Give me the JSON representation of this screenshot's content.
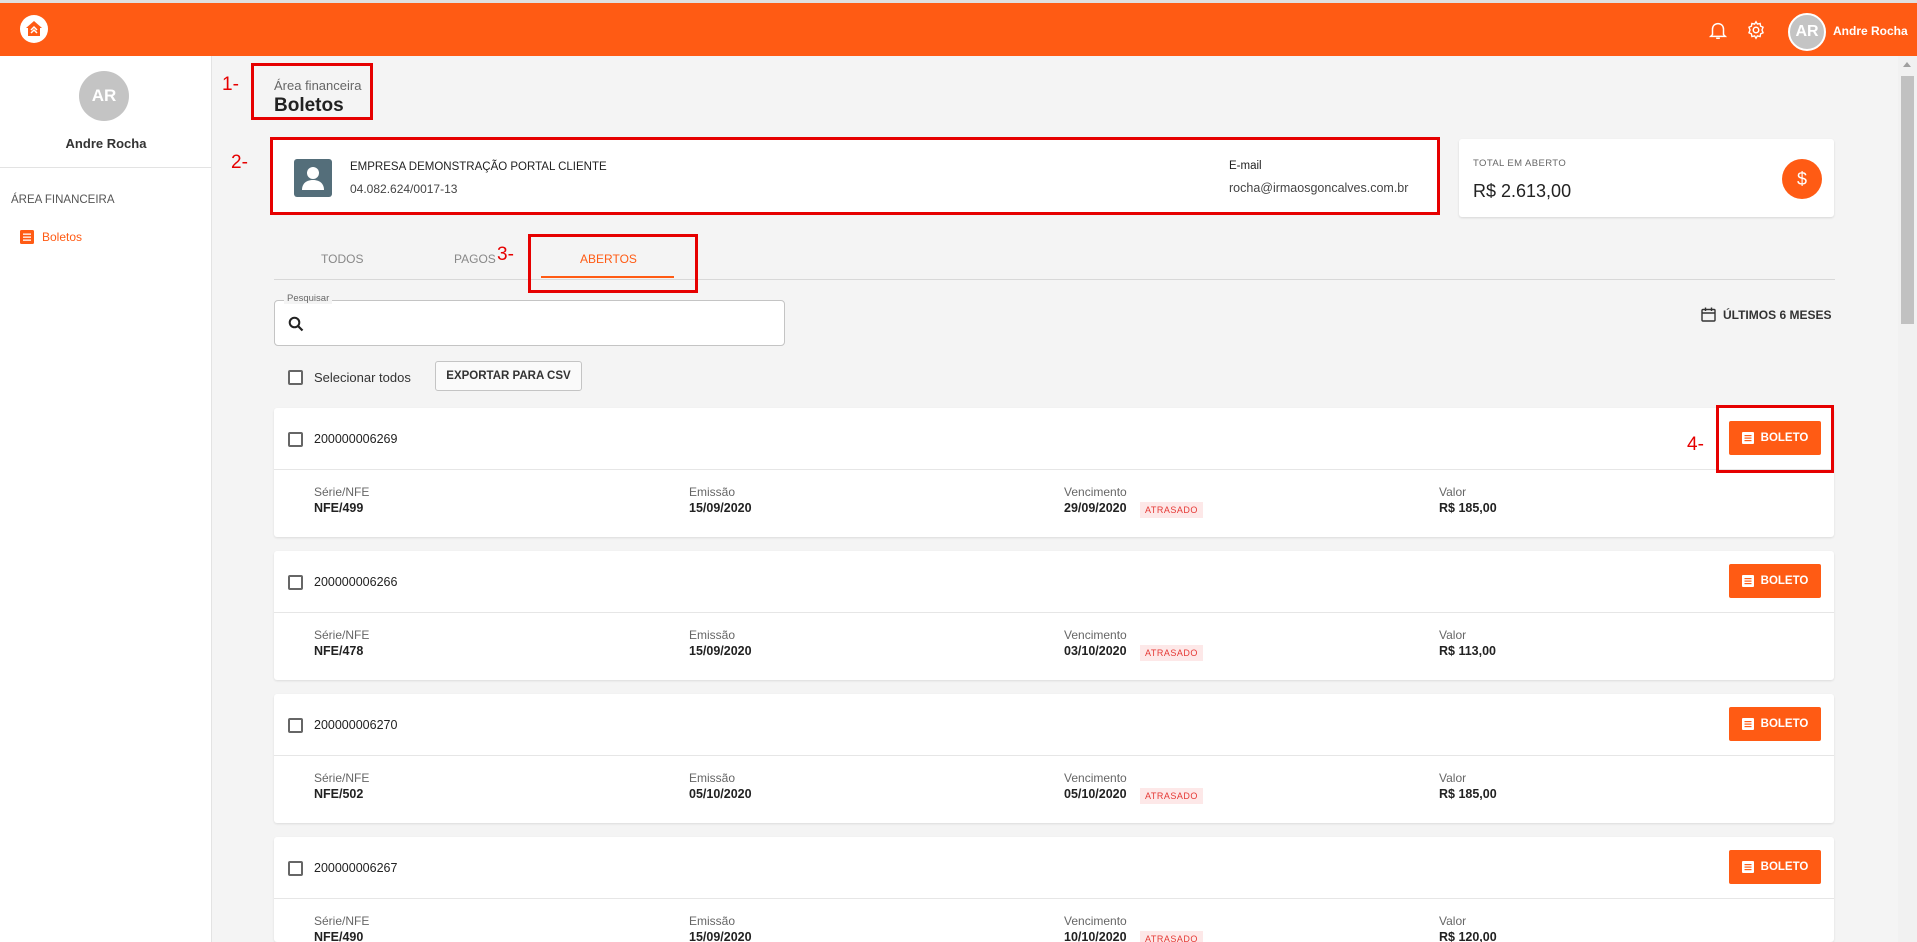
{
  "header": {
    "user_initials": "AR",
    "user_name": "Andre Rocha",
    "icons": [
      "bell-icon",
      "gear-icon"
    ]
  },
  "sidebar": {
    "avatar_initials": "AR",
    "user_name": "Andre Rocha",
    "section": "ÁREA FINANCEIRA",
    "items": [
      {
        "label": "Boletos",
        "icon": "list-icon"
      }
    ]
  },
  "annotations": [
    "1-",
    "2-",
    "3-",
    "4-"
  ],
  "breadcrumb": {
    "parent": "Área financeira",
    "title": "Boletos"
  },
  "company": {
    "name": "EMPRESA DEMONSTRAÇÃO PORTAL CLIENTE",
    "cnpj": "04.082.624/0017-13",
    "email_label": "E-mail",
    "email": "rocha@irmaosgoncalves.com.br"
  },
  "total": {
    "label": "TOTAL EM ABERTO",
    "value": "R$ 2.613,00",
    "icon": "$"
  },
  "tabs": [
    {
      "label": "TODOS",
      "active": false
    },
    {
      "label": "PAGOS",
      "active": false
    },
    {
      "label": "ABERTOS",
      "active": true
    }
  ],
  "search": {
    "label": "Pesquisar",
    "value": ""
  },
  "period": {
    "label": "ÚLTIMOS 6 MESES"
  },
  "toolbar": {
    "select_all": "Selecionar todos",
    "export_csv": "EXPORTAR PARA CSV"
  },
  "columns": {
    "serie": "Série/NFE",
    "emissao": "Emissão",
    "vencimento": "Vencimento",
    "valor": "Valor"
  },
  "boleto_label": "BOLETO",
  "rows": [
    {
      "number": "200000006269",
      "serie": "NFE/499",
      "emissao": "15/09/2020",
      "vencimento": "29/09/2020",
      "status": "ATRASADO",
      "valor": "R$ 185,00"
    },
    {
      "number": "200000006266",
      "serie": "NFE/478",
      "emissao": "15/09/2020",
      "vencimento": "03/10/2020",
      "status": "ATRASADO",
      "valor": "R$ 113,00"
    },
    {
      "number": "200000006270",
      "serie": "NFE/502",
      "emissao": "05/10/2020",
      "vencimento": "05/10/2020",
      "status": "ATRASADO",
      "valor": "R$ 185,00"
    },
    {
      "number": "200000006267",
      "serie": "NFE/490",
      "emissao": "15/09/2020",
      "vencimento": "10/10/2020",
      "status": "ATRASADO",
      "valor": "R$ 120,00"
    }
  ],
  "colors": {
    "accent": "#ff5b14",
    "annotation": "#e60000",
    "late": "#e53935"
  }
}
